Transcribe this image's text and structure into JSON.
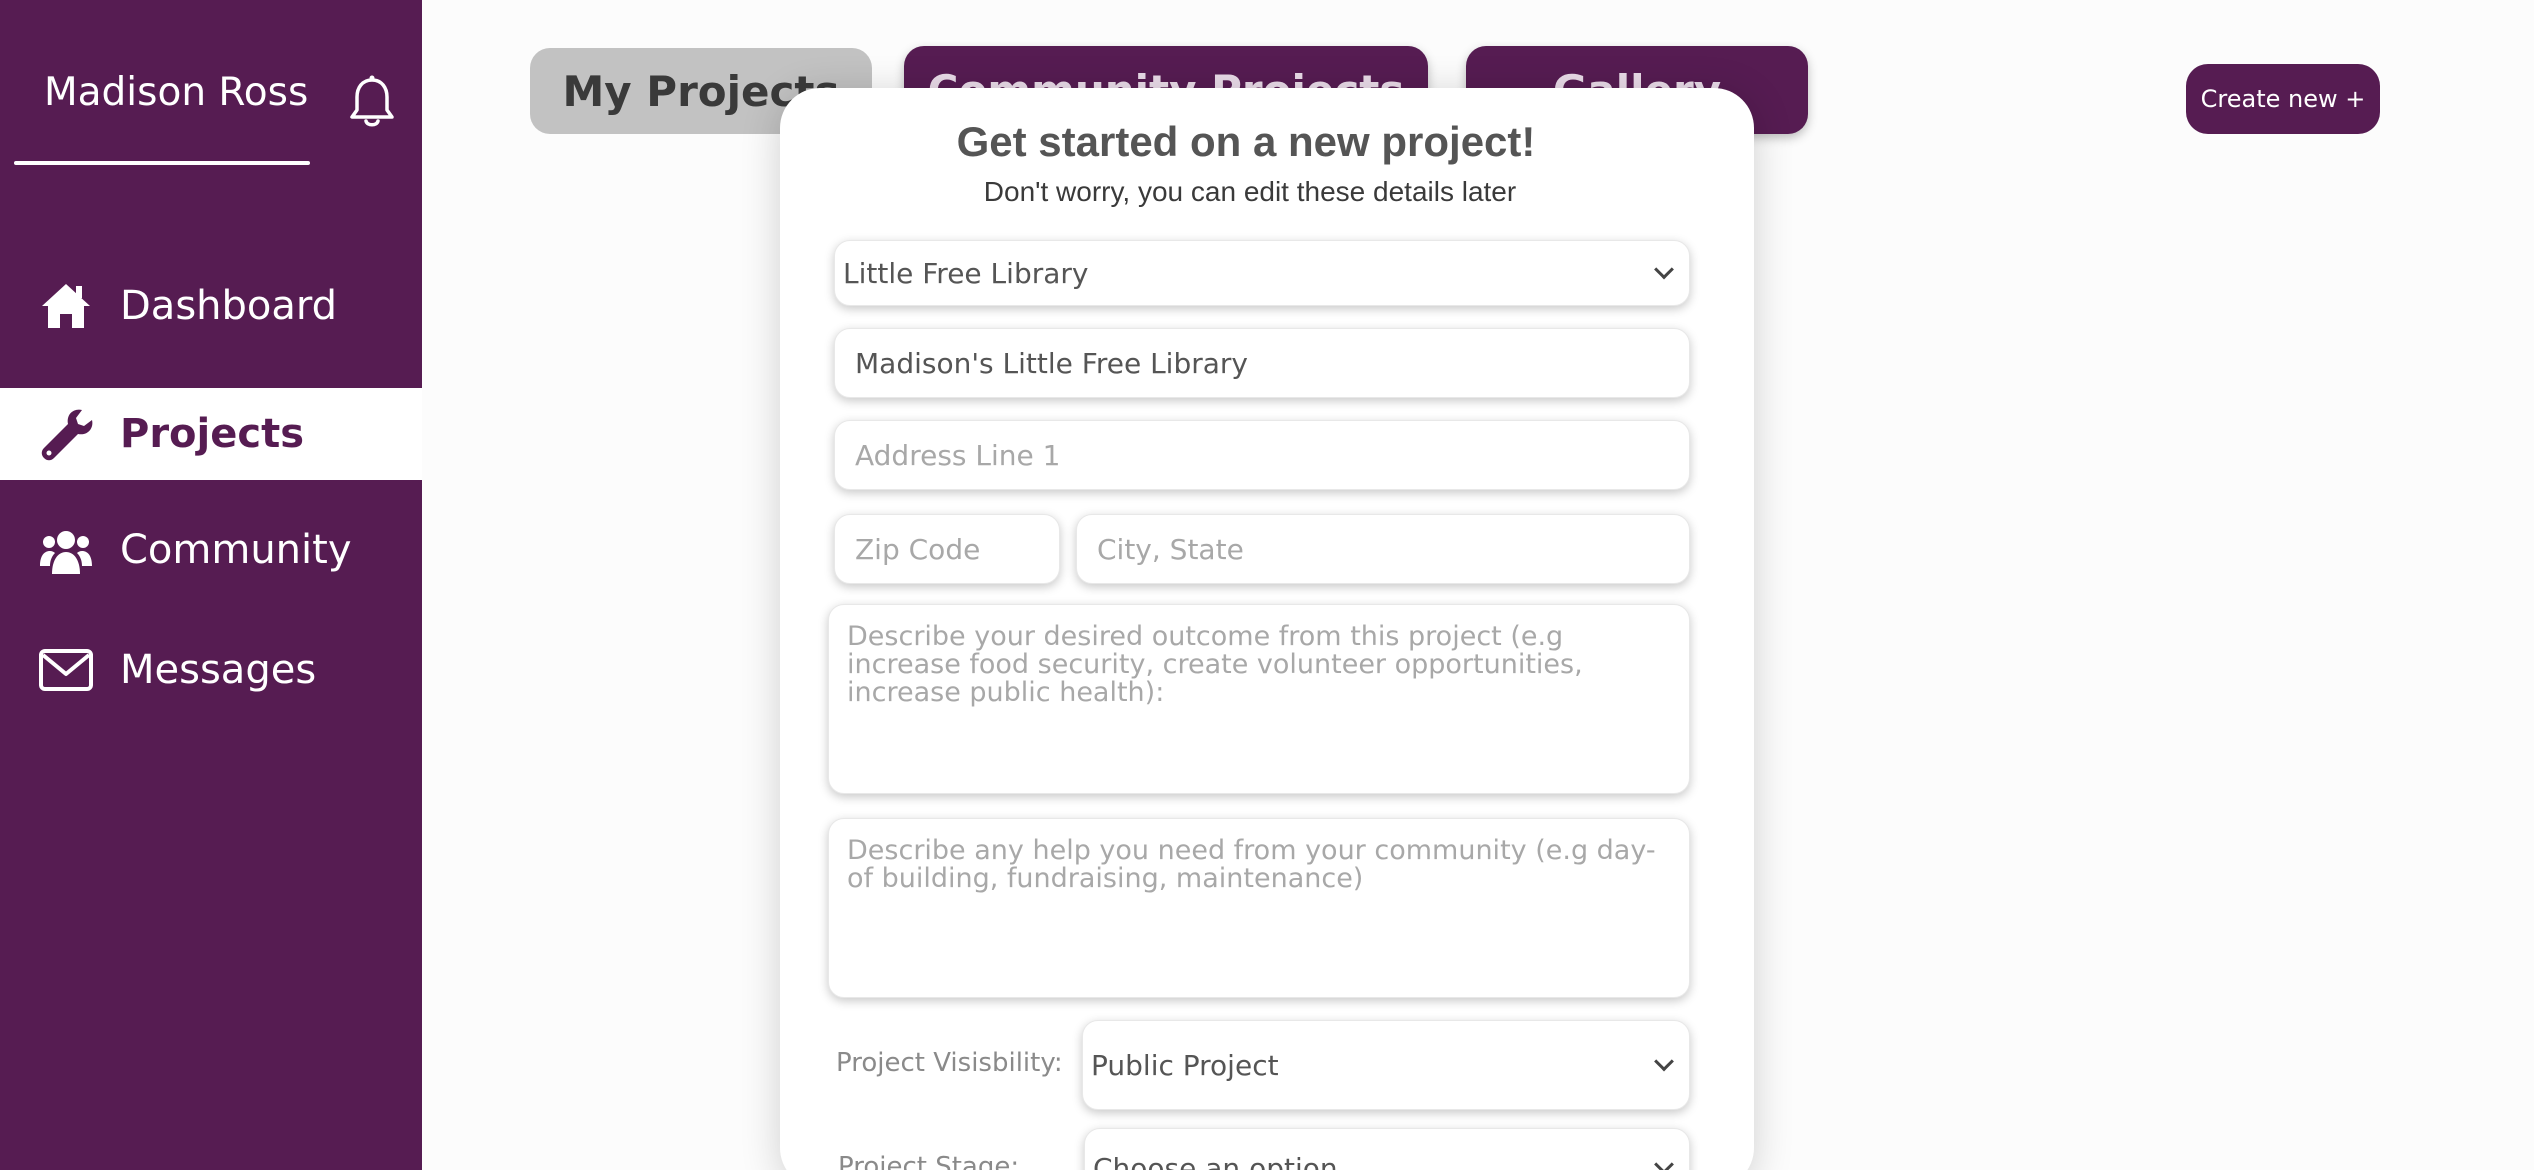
{
  "sidebar": {
    "user_name": "Madison Ross",
    "items": [
      {
        "label": "Dashboard",
        "icon": "home-icon"
      },
      {
        "label": "Projects",
        "icon": "wrench-icon"
      },
      {
        "label": "Community",
        "icon": "users-icon"
      },
      {
        "label": "Messages",
        "icon": "envelope-icon"
      }
    ],
    "active": "Projects"
  },
  "tabs": {
    "my_projects": "My Projects",
    "community_projects": "Community Projects",
    "gallery": "Gallery"
  },
  "create_button": "Create new +",
  "modal": {
    "title": "Get started on a new project!",
    "subtitle": "Don't worry, you can edit these details later",
    "project_type": "Little Free Library",
    "project_name": "Madison's Little Free Library",
    "address_placeholder": "Address Line 1",
    "zip_placeholder": "Zip Code",
    "city_placeholder": "City, State",
    "outcome_placeholder": "Describe your desired outcome from this project (e.g increase food security, create volunteer opportunities, increase public health):",
    "help_placeholder": "Describe any help you need from your community (e.g day-of building, fundraising, maintenance)",
    "visibility_label": "Project Visisbility:",
    "visibility_value": "Public Project",
    "stage_label": "Project Stage:",
    "stage_value": "Choose an option"
  },
  "colors": {
    "brand": "#561c52",
    "inactive_tab": "#c2c2c2",
    "background": "#fcfcfc"
  }
}
